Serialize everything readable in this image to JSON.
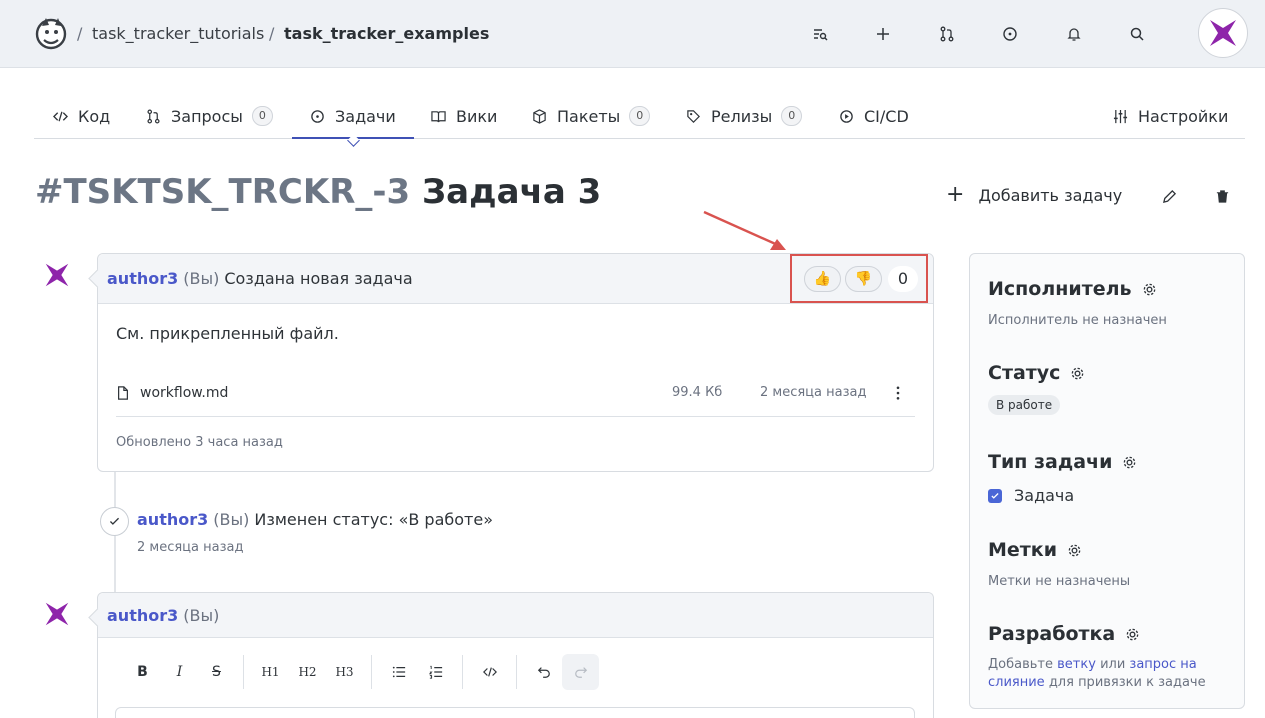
{
  "topbar": {
    "breadcrumb": [
      {
        "sep": "/",
        "label": "task_tracker_tutorials"
      },
      {
        "sep": "/",
        "label": "task_tracker_examples"
      }
    ],
    "icons": [
      "search-list-icon",
      "plus-icon",
      "merge-request-icon",
      "issue-icon",
      "bell-icon",
      "search-icon"
    ],
    "accent": "#8e24aa"
  },
  "tabs": [
    {
      "label": "Код",
      "icon": "code-icon"
    },
    {
      "label": "Запросы",
      "count": "0",
      "icon": "merge-request-icon"
    },
    {
      "label": "Задачи",
      "icon": "issue-icon",
      "active": true
    },
    {
      "label": "Вики",
      "icon": "book-icon"
    },
    {
      "label": "Пакеты",
      "count": "0",
      "icon": "package-icon"
    },
    {
      "label": "Релизы",
      "count": "0",
      "icon": "tag-icon"
    },
    {
      "label": "CI/CD",
      "icon": "play-icon"
    },
    {
      "label": "Настройки",
      "icon": "sliders-icon"
    }
  ],
  "issue": {
    "id": "#TSKTSK_TRCKR_-3",
    "title": "Задача 3",
    "add_task_label": "Добавить задачу"
  },
  "comment1": {
    "author": "author3",
    "you": "(Вы)",
    "message": "Создана новая задача",
    "body": "См. прикрепленный файл.",
    "reactions": {
      "like": "👍",
      "dislike": "👎",
      "count": "0"
    },
    "file": {
      "name": "workflow.md",
      "size": "99.4 Кб",
      "date": "2 месяца назад"
    },
    "updated": "Обновлено 3 часа назад"
  },
  "event": {
    "author": "author3",
    "you": "(Вы)",
    "message": "Изменен статус: «В работе»",
    "date": "2 месяца назад"
  },
  "comment2": {
    "author": "author3",
    "you": "(Вы)",
    "toolbar": [
      "B",
      "I",
      "S",
      "H1",
      "H2",
      "H3"
    ]
  },
  "sidebar": {
    "assignee": {
      "title": "Исполнитель",
      "note": "Исполнитель не назначен"
    },
    "status": {
      "title": "Статус",
      "value": "В работе"
    },
    "type": {
      "title": "Тип задачи",
      "value": "Задача"
    },
    "labels": {
      "title": "Метки",
      "note": "Метки не назначены"
    },
    "dev": {
      "title": "Разработка",
      "text1": "Добавьте",
      "link1": "ветку",
      "text2": "или",
      "link2": "запрос на слияние",
      "text3": "для привязки к задаче"
    }
  }
}
